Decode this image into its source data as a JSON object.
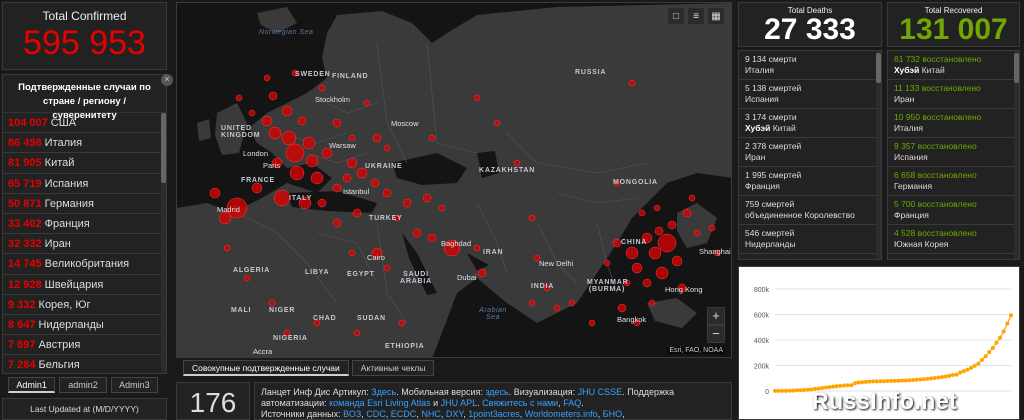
{
  "confirmed": {
    "label": "Total Confirmed",
    "value": "595 953"
  },
  "country_panel": {
    "heading": "Подтвержденные случаи по стране / региону / суверенитету",
    "rows": [
      {
        "value": "104 007",
        "name": "США"
      },
      {
        "value": "86 498",
        "name": "Италия"
      },
      {
        "value": "81 905",
        "name": "Китай"
      },
      {
        "value": "65 719",
        "name": "Испания"
      },
      {
        "value": "50 871",
        "name": "Германия"
      },
      {
        "value": "33 402",
        "name": "Франция"
      },
      {
        "value": "32 332",
        "name": "Иран"
      },
      {
        "value": "14 745",
        "name": "Великобритания"
      },
      {
        "value": "12 928",
        "name": "Швейцария"
      },
      {
        "value": "9 332",
        "name": "Корея, Юг"
      },
      {
        "value": "8 647",
        "name": "Нидерланды"
      },
      {
        "value": "7 697",
        "name": "Австрия"
      },
      {
        "value": "7 284",
        "name": "Бельгия"
      }
    ]
  },
  "admin_tabs": [
    "Admin1",
    "admin2",
    "Admin3"
  ],
  "last_updated": "Last Updated at (M/D/YYYY)",
  "map": {
    "tools": [
      "bookmark-icon",
      "list-icon",
      "grid-icon"
    ],
    "labels": {
      "norwegian_sea": "Norwegian Sea",
      "russia": "RUSSIA",
      "sweden": "SWEDEN",
      "finland": "FINLAND",
      "stockholm": "Stockholm",
      "moscow": "Moscow",
      "united_kingdom": "UNITED KINGDOM",
      "london": "London",
      "warsaw": "Warsaw",
      "paris": "Paris",
      "ukraine": "UKRAINE",
      "kazakhstan": "KAZAKHSTAN",
      "mongolia": "MONGOLIA",
      "france": "FRANCE",
      "madrid": "Madrid",
      "italy": "ITALY",
      "istanbul": "Istanbul",
      "turkey": "TURKEY",
      "china": "CHINA",
      "baghdad": "Baghdad",
      "iran": "IRAN",
      "shanghai": "Shanghai",
      "algeria": "ALGERIA",
      "libya": "LIBYA",
      "egypt": "EGYPT",
      "cairo": "Cairo",
      "saudi_arabia": "SAUDI ARABIA",
      "dubai": "Dubai",
      "new_delhi": "New Delhi",
      "india": "INDIA",
      "myanmar": "MYANMAR (BURMA)",
      "hong_kong": "Hong Kong",
      "mali": "MALI",
      "niger": "NIGER",
      "chad": "CHAD",
      "sudan": "SUDAN",
      "arabian_sea": "Arabian Sea",
      "bangkok": "Bangkok",
      "nigeria": "NIGERIA",
      "ethiopia": "ETHIOPIA",
      "accra": "Accra"
    },
    "zoom_in": "+",
    "zoom_out": "−",
    "attribution": "Esri, FAO, NOAA"
  },
  "map_tabs": [
    "Совокупные подтвержденные случаи",
    "Активные чеклы"
  ],
  "count_box": "176",
  "info": {
    "t1": "Ланцет Инф Дис Артикул: ",
    "a1": "Здесь",
    "t2": ". Мобильная версия: ",
    "a2": "здесь",
    "t3": ". Визуализация: ",
    "a3": "JHU CSSE",
    "t4": ". Поддержка автоматизации: ",
    "a4": "команда Esri Living Atlas",
    "t5": " и ",
    "a5": "JHU APL",
    "t6": ". ",
    "a6": "Свяжитесь с нами",
    "t7": ", ",
    "a7": "FAQ",
    "t8": ".",
    "t9": "Источники данных: ",
    "a8": "ВОЗ",
    "a9": "CDC",
    "a10": "ECDC",
    "a11": "NHC",
    "a12": "DXY",
    "a13": "1point3acres",
    "a14": "Worldometers.info",
    "a15": "БНО"
  },
  "deaths": {
    "label": "Total Deaths",
    "value": "27 333",
    "rows": [
      {
        "count": "9 134",
        "unit": "смерти",
        "place": "Италия",
        "bold": ""
      },
      {
        "count": "5 138",
        "unit": "смертей",
        "place": "Испания",
        "bold": ""
      },
      {
        "count": "3 174",
        "unit": "смерти",
        "place": "Китай",
        "bold": "Хубэй"
      },
      {
        "count": "2 378",
        "unit": "смертей",
        "place": "Иран",
        "bold": ""
      },
      {
        "count": "1 995",
        "unit": "смертей",
        "place": "Франция",
        "bold": ""
      },
      {
        "count": "759",
        "unit": "смертей",
        "place": "объединенное Королевство",
        "bold": ""
      },
      {
        "count": "546",
        "unit": "смертей",
        "place": "Нидерланды",
        "bold": ""
      }
    ]
  },
  "recovered": {
    "label": "Total Recovered",
    "value": "131 007",
    "rows": [
      {
        "count": "61 732",
        "unit": "восстановлено",
        "place": "Китай",
        "bold": "Хубэй"
      },
      {
        "count": "11 133",
        "unit": "восстановлено",
        "place": "Иран",
        "bold": ""
      },
      {
        "count": "10 950",
        "unit": "восстановлено",
        "place": "Италия",
        "bold": ""
      },
      {
        "count": "9 357",
        "unit": "восстановлено",
        "place": "Испания",
        "bold": ""
      },
      {
        "count": "6 658",
        "unit": "восстановлено",
        "place": "Германия",
        "bold": ""
      },
      {
        "count": "5 700",
        "unit": "восстановлено",
        "place": "Франция",
        "bold": ""
      },
      {
        "count": "4 528",
        "unit": "восстановлено",
        "place": "Южная Корея",
        "bold": ""
      }
    ]
  },
  "colors": {
    "confirmed": "#e60000",
    "recovered": "#70a800",
    "link": "#36a3ff",
    "chart_line": "#ffa500"
  },
  "chart_data": {
    "type": "line",
    "y_ticks": [
      "800k",
      "600k",
      "400k",
      "200k",
      "0"
    ],
    "ylim": [
      0,
      800000
    ],
    "values": [
      555,
      654,
      941,
      1434,
      2118,
      2927,
      5578,
      6166,
      8234,
      9927,
      12038,
      16787,
      19881,
      23892,
      27635,
      30794,
      34391,
      37120,
      40150,
      42762,
      44802,
      45221,
      60368,
      66885,
      69030,
      71224,
      73258,
      75136,
      75639,
      76197,
      76819,
      78572,
      78958,
      79561,
      80406,
      81388,
      82746,
      84112,
      86011,
      88369,
      90306,
      92840,
      95120,
      97886,
      101801,
      105847,
      109821,
      113590,
      118620,
      125875,
      128343,
      145193,
      156097,
      167449,
      181546,
      197168,
      214915,
      242713,
      272167,
      304528,
      336953,
      378235,
      418045,
      467653,
      529591,
      593291
    ]
  },
  "watermark": "RussInfo.net"
}
